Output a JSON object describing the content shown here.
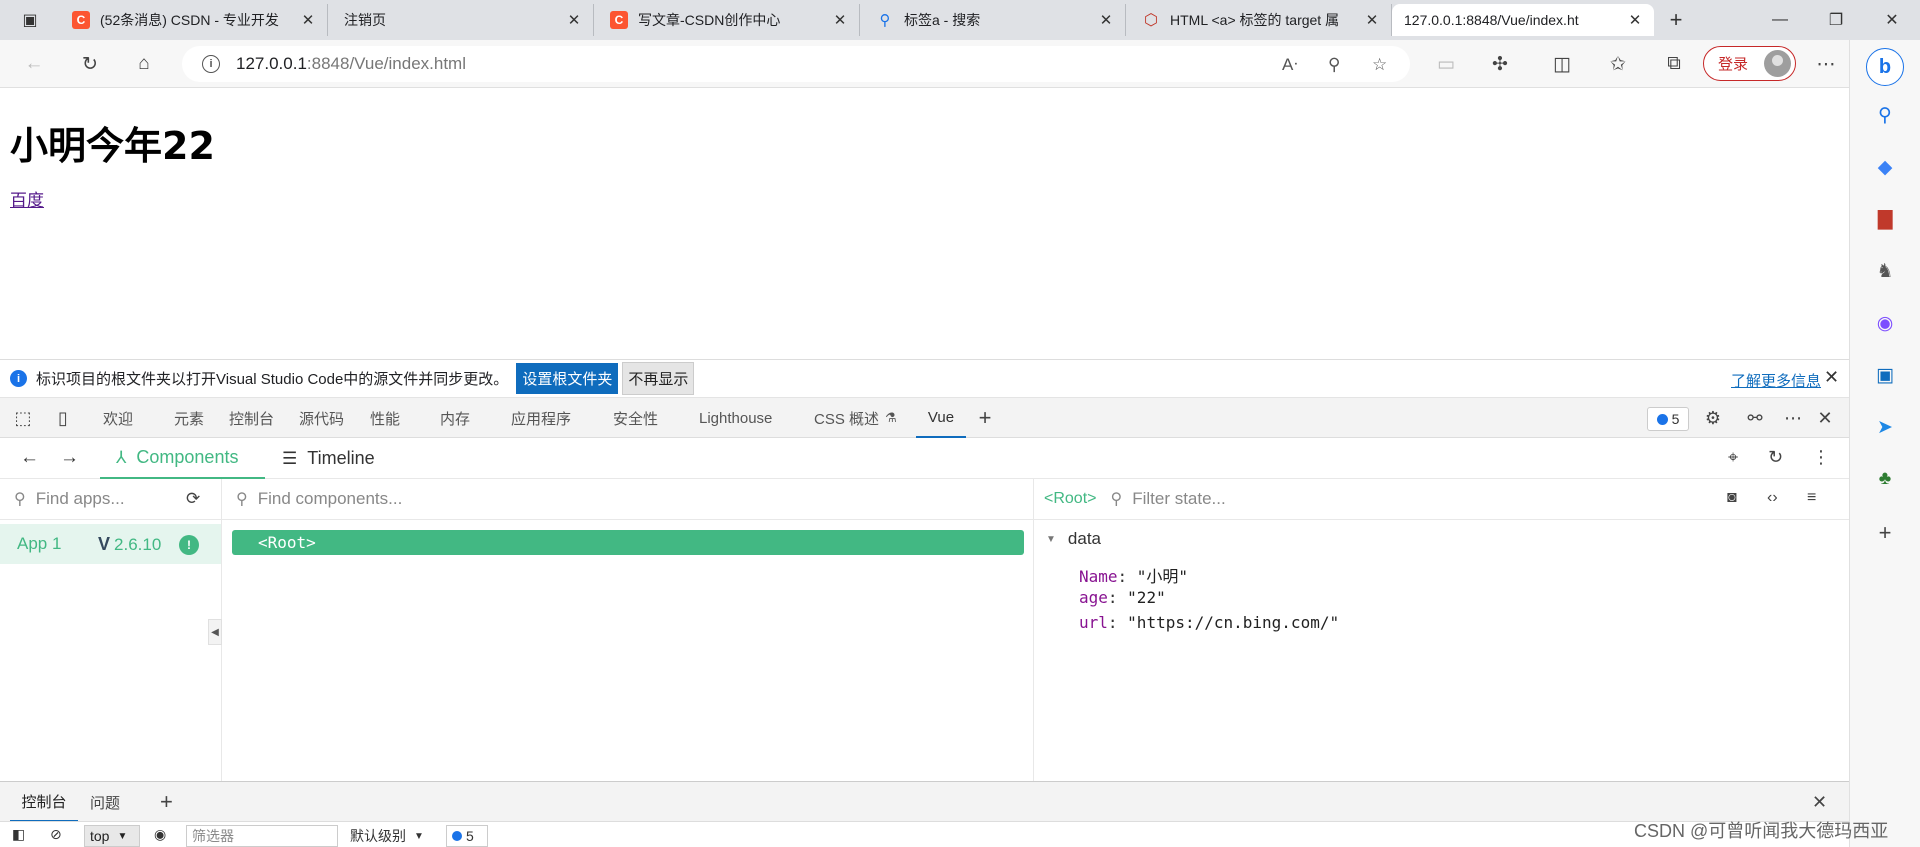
{
  "browser": {
    "tabs": [
      {
        "title": "(52条消息) CSDN - 专业开发",
        "icon": "csdn-icon"
      },
      {
        "title": "注销页",
        "icon": "page-icon"
      },
      {
        "title": "写文章-CSDN创作中心",
        "icon": "csdn-icon"
      },
      {
        "title": "标签a - 搜索",
        "icon": "search-icon"
      },
      {
        "title": "HTML <a> 标签的 target 属",
        "icon": "w3-icon"
      },
      {
        "title": "127.0.0.1:8848/Vue/index.ht",
        "icon": "page-icon"
      }
    ],
    "active_tab": 5,
    "url_host": "127.0.0.1",
    "url_rest": ":8848/Vue/index.html",
    "login_label": "登录"
  },
  "page": {
    "heading": "小明今年22",
    "link_text": "百度"
  },
  "infobar": {
    "message": "标识项目的根文件夹以打开Visual Studio Code中的源文件并同步更改。",
    "set_root_label": "设置根文件夹",
    "dont_show_label": "不再显示",
    "learn_more_label": "了解更多信息"
  },
  "devtools": {
    "tabs": [
      "欢迎",
      "元素",
      "控制台",
      "源代码",
      "性能",
      "内存",
      "应用程序",
      "安全性",
      "Lighthouse",
      "CSS 概述",
      "Vue"
    ],
    "active_tab": "Vue",
    "issues_count": "5"
  },
  "vue": {
    "tabs": {
      "components": "Components",
      "timeline": "Timeline"
    },
    "apps_search_placeholder": "Find apps...",
    "components_search_placeholder": "Find components...",
    "state_filter_placeholder": "Filter state...",
    "app": {
      "name": "App 1",
      "version": "2.6.10"
    },
    "root_node": "<Root>",
    "state_root_label": "<Root>",
    "state_section": "data",
    "props": [
      {
        "key": "Name",
        "value": "\"小明\""
      },
      {
        "key": "age",
        "value": "\"22\""
      },
      {
        "key": "url",
        "value": "\"https://cn.bing.com/\""
      }
    ]
  },
  "drawer": {
    "tabs": [
      "控制台",
      "问题"
    ],
    "context": "top",
    "filter_placeholder": "筛选器",
    "level": "默认级别",
    "issues_count": "5"
  },
  "watermark": "CSDN @可曾听闻我大德玛西亚",
  "colors": {
    "vue_green": "#42b883",
    "edge_blue": "#0f6cbd",
    "csdn_red": "#fc5531"
  }
}
